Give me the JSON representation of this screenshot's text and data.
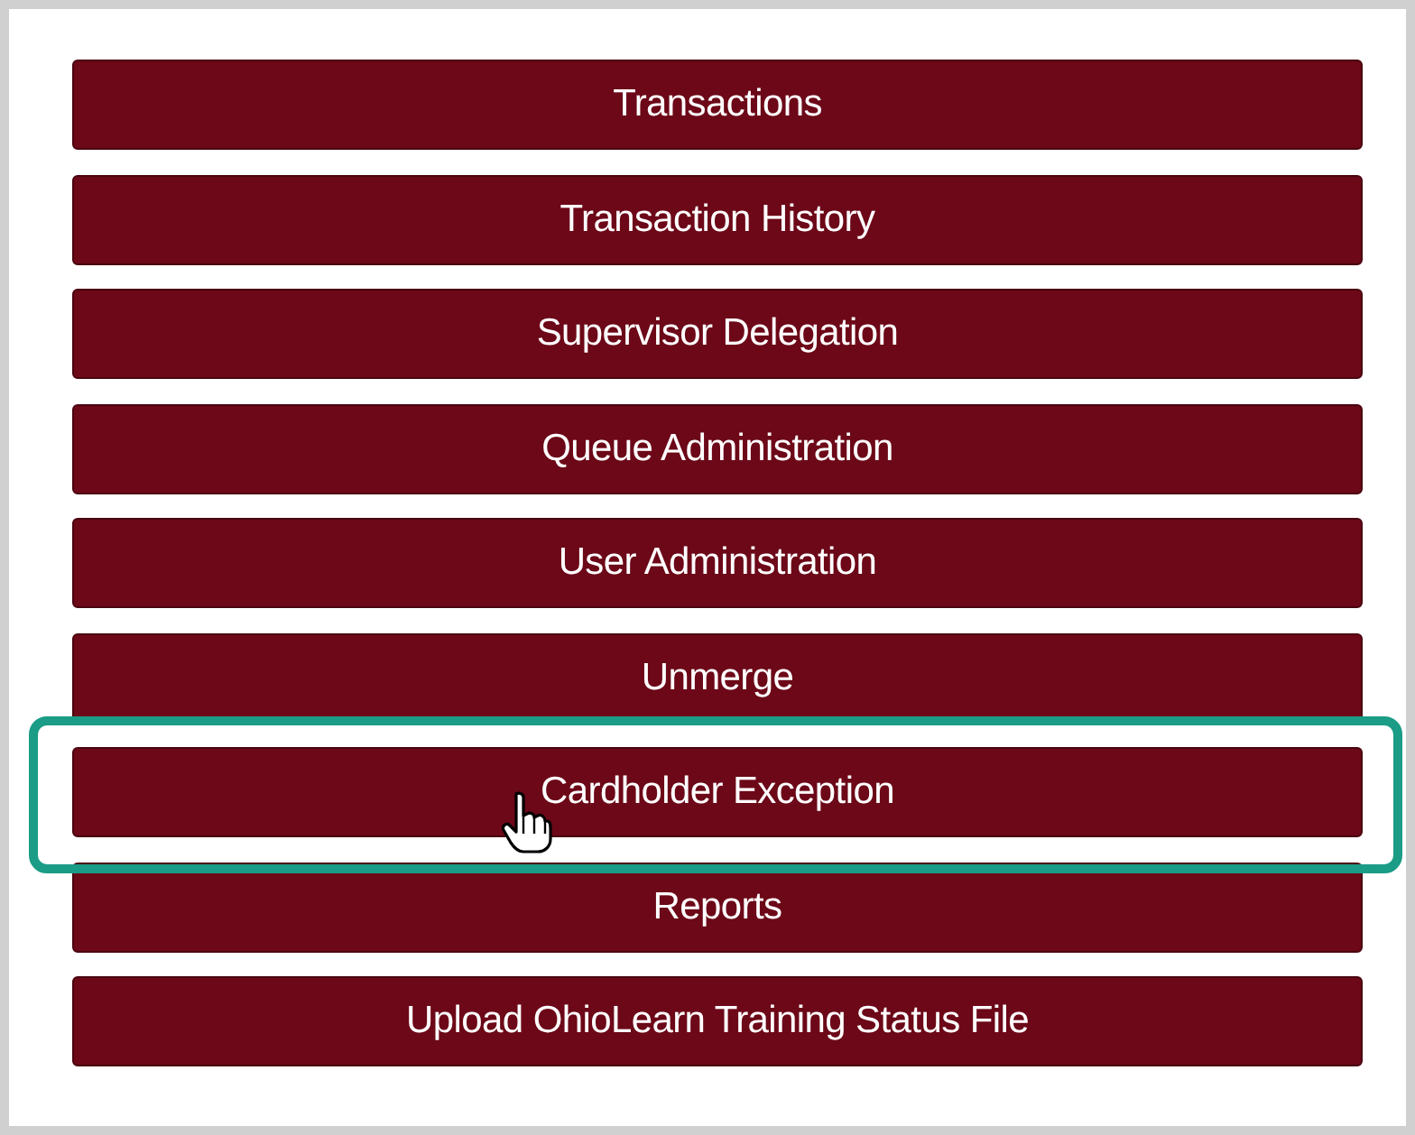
{
  "menu_buttons": [
    {
      "label": "Transactions",
      "highlighted": false
    },
    {
      "label": "Transaction History",
      "highlighted": false
    },
    {
      "label": "Supervisor Delegation",
      "highlighted": false
    },
    {
      "label": "Queue Administration",
      "highlighted": false
    },
    {
      "label": "User Administration",
      "highlighted": false
    },
    {
      "label": "Unmerge",
      "highlighted": false
    },
    {
      "label": "Cardholder Exception",
      "highlighted": true
    },
    {
      "label": "Reports",
      "highlighted": false
    },
    {
      "label": "Upload OhioLearn Training Status File",
      "highlighted": false
    }
  ]
}
